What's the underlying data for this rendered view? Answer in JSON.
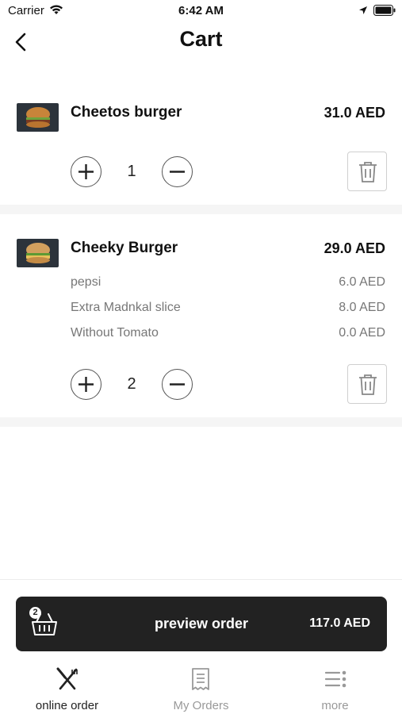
{
  "status_bar": {
    "carrier": "Carrier",
    "time": "6:42 AM"
  },
  "header": {
    "title": "Cart"
  },
  "cart": {
    "items": [
      {
        "name": "Cheetos burger",
        "price": "31.0 AED",
        "quantity": "1",
        "addons": []
      },
      {
        "name": "Cheeky Burger",
        "price": "29.0 AED",
        "quantity": "2",
        "addons": [
          {
            "name": "pepsi",
            "price": "6.0 AED"
          },
          {
            "name": "Extra Madnkal slice",
            "price": "8.0 AED"
          },
          {
            "name": "Without Tomato",
            "price": "0.0 AED"
          }
        ]
      }
    ]
  },
  "preview": {
    "badge_count": "2",
    "label": "preview order",
    "total": "117.0 AED"
  },
  "tabs": [
    {
      "label": "online order",
      "icon": "fork-knife-icon",
      "active": true
    },
    {
      "label": "My Orders",
      "icon": "receipt-icon",
      "active": false
    },
    {
      "label": "more",
      "icon": "menu-more-icon",
      "active": false
    }
  ],
  "colors": {
    "primary_dark": "#222222",
    "muted": "#999999"
  }
}
